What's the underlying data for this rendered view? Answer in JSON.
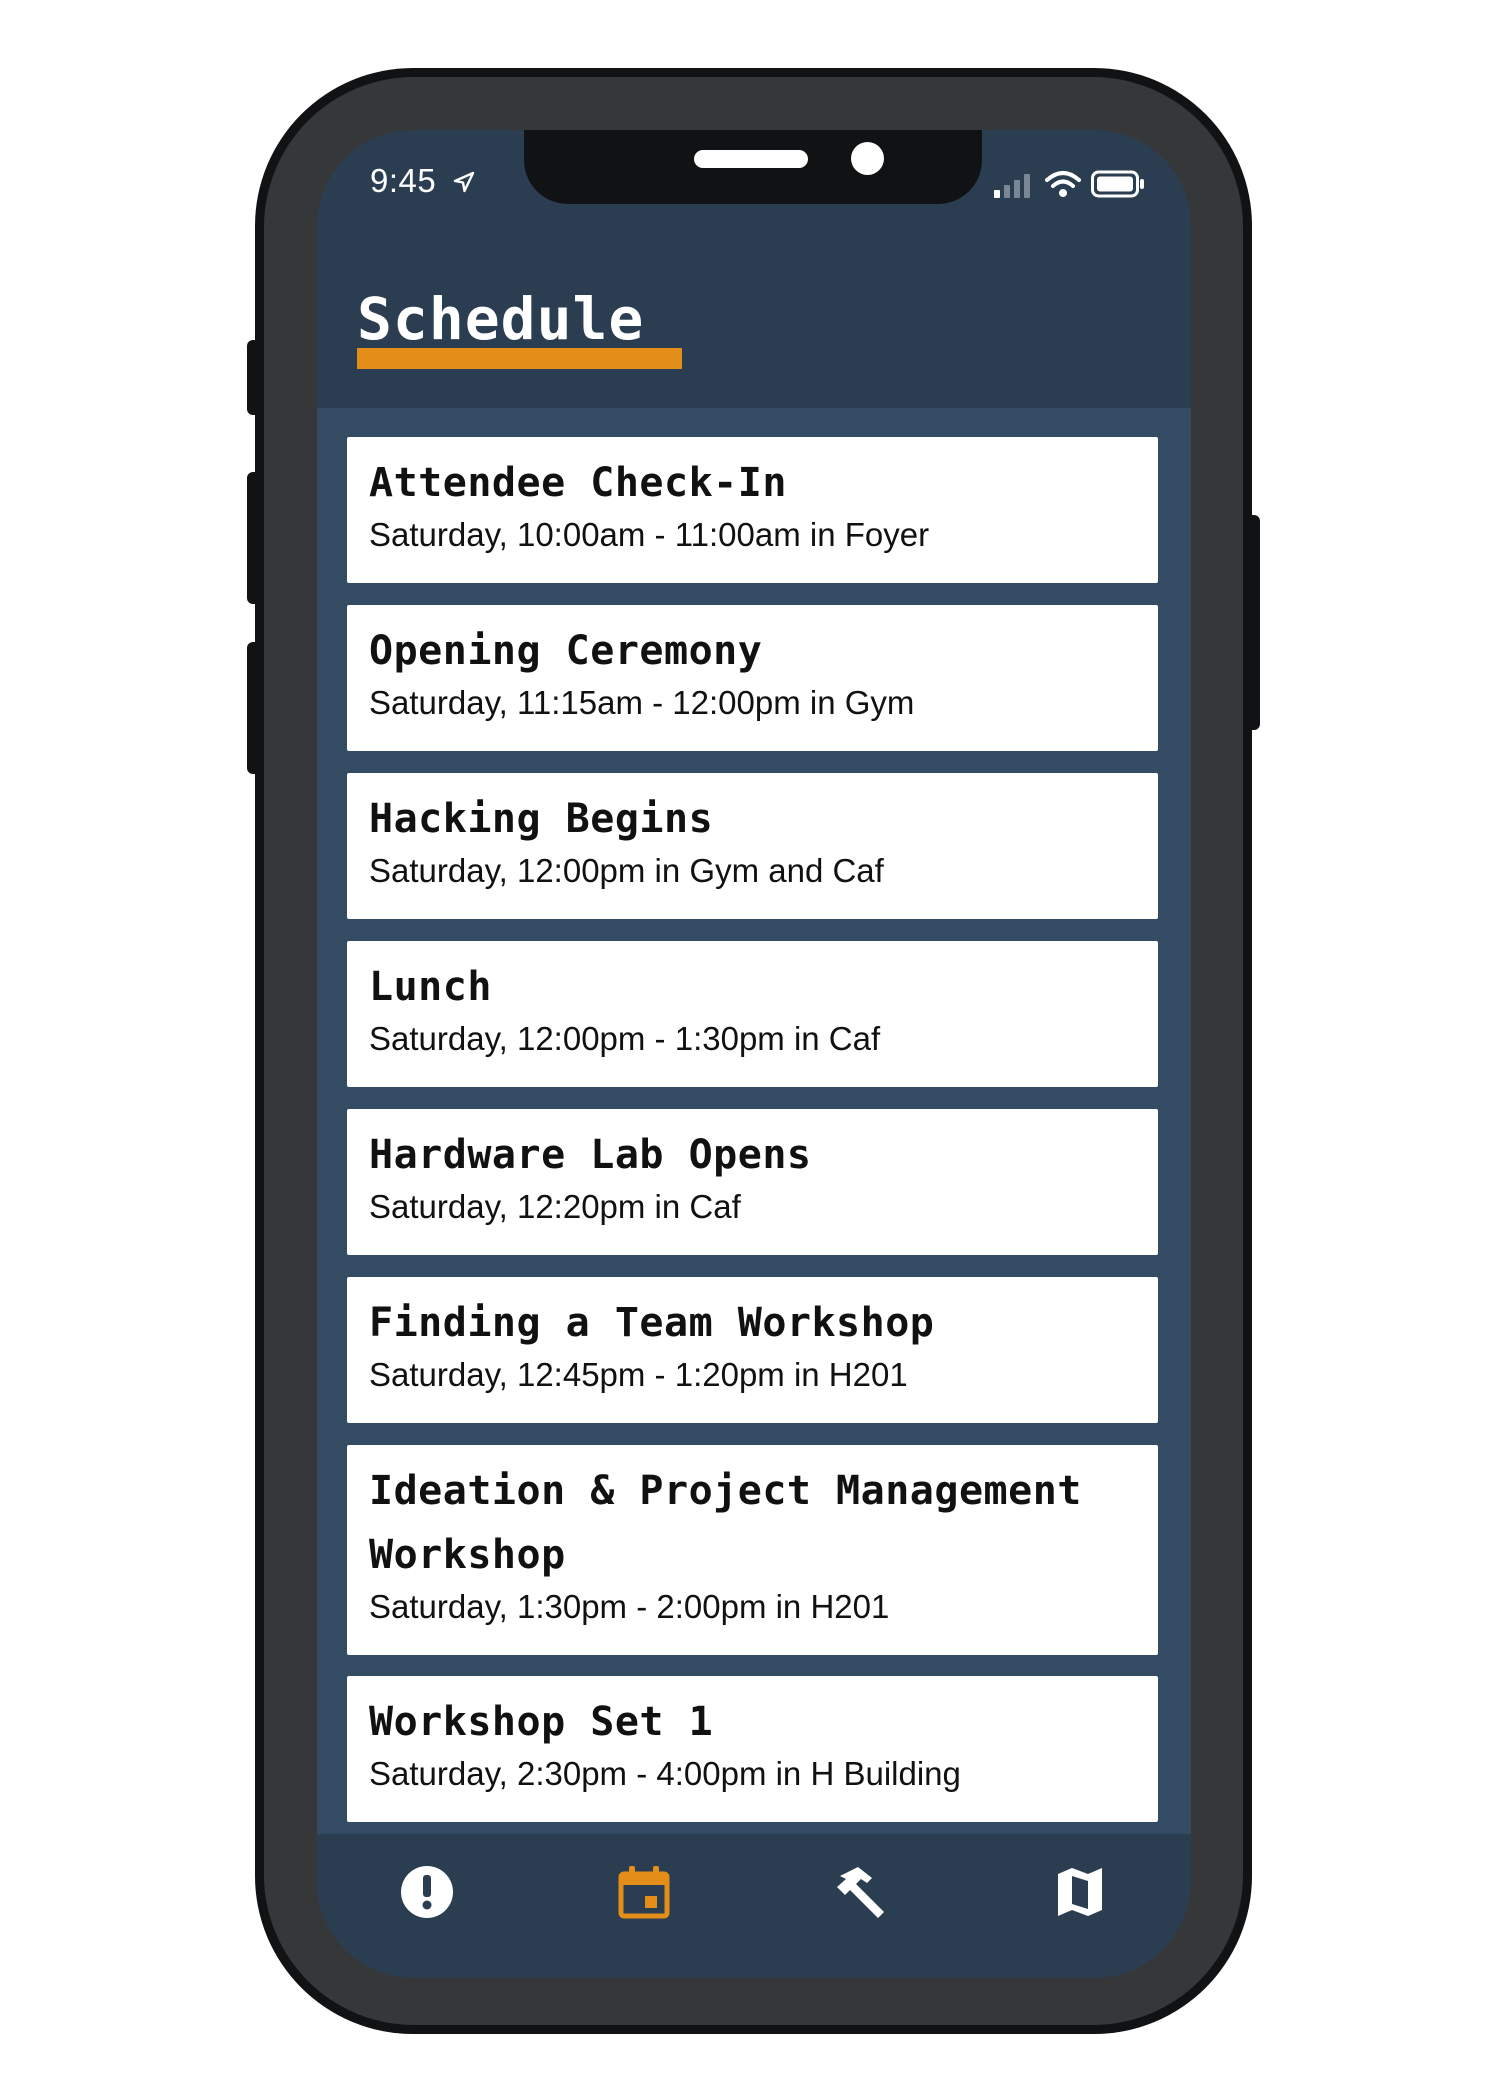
{
  "status_bar": {
    "time": "9:45"
  },
  "header": {
    "title": "Schedule"
  },
  "events": [
    {
      "title": "Attendee Check-In",
      "details": "Saturday, 10:00am - 11:00am in Foyer"
    },
    {
      "title": "Opening Ceremony",
      "details": "Saturday, 11:15am - 12:00pm in Gym"
    },
    {
      "title": "Hacking Begins",
      "details": "Saturday, 12:00pm in Gym and Caf"
    },
    {
      "title": "Lunch",
      "details": "Saturday, 12:00pm - 1:30pm in Caf"
    },
    {
      "title": "Hardware Lab Opens",
      "details": "Saturday, 12:20pm in Caf"
    },
    {
      "title": "Finding a Team Workshop",
      "details": "Saturday, 12:45pm - 1:20pm in H201"
    },
    {
      "title": "Ideation & Project Management Workshop",
      "details": "Saturday, 1:30pm - 2:00pm in H201"
    },
    {
      "title": "Workshop Set 1",
      "details": "Saturday, 2:30pm - 4:00pm in H Building"
    }
  ],
  "tab_bar": {
    "tabs": [
      {
        "icon": "alert-icon",
        "active": false
      },
      {
        "icon": "calendar-icon",
        "active": true
      },
      {
        "icon": "hammer-icon",
        "active": false
      },
      {
        "icon": "map-icon",
        "active": false
      }
    ]
  },
  "colors": {
    "accent": "#e48e19",
    "header_bg": "#2b3d50",
    "list_bg": "#344b64",
    "card_bg": "#ffffff"
  }
}
